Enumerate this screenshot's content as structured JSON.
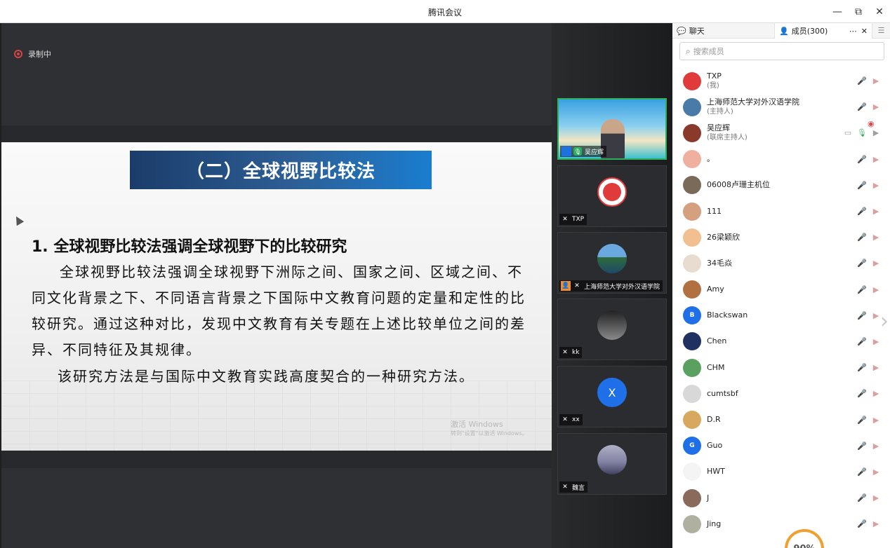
{
  "window": {
    "title": "腾讯会议",
    "minimize": "—",
    "restore": "⧉",
    "close": "✕"
  },
  "stage": {
    "recording_label": "录制中",
    "slide": {
      "banner": "（二）全球视野比较法",
      "heading": "1. 全球视野比较法强调全球视野下的比较研究",
      "paragraph": "全球视野比较法强调全球视野下洲际之间、国家之间、区域之间、不同文化背景之下、不同语言背景之下国际中文教育问题的定量和定性的比较研究。通过这种对比，发现中文教育有关专题在上述比较单位之间的差异、不同特征及其规律。",
      "paragraph2": "该研究方法是与国际中文教育实践高度契合的一种研究方法。",
      "watermark_line1": "激活 Windows",
      "watermark_line2": "转到\"设置\"以激活 Windows。"
    }
  },
  "video_tiles": [
    {
      "name": "吴应辉",
      "type": "video",
      "speaking": true
    },
    {
      "name": "TXP",
      "type": "avatar"
    },
    {
      "name": "上海师范大学对外汉语学院",
      "type": "avatar"
    },
    {
      "name": "kk",
      "type": "avatar"
    },
    {
      "name": "xx",
      "type": "letter",
      "letter": "X"
    },
    {
      "name": "魏言",
      "type": "avatar"
    }
  ],
  "panel": {
    "tab_chat": "聊天",
    "tab_members": "成员(300)",
    "tab_more": "⋯",
    "tab_close": "✕",
    "search_placeholder": "搜索成员",
    "gauge": "90%",
    "members": [
      {
        "name": "TXP",
        "role": "(我)",
        "avatar_color": "#e03a3a"
      },
      {
        "name": "上海师范大学对外汉语学院",
        "role": "(主持人)",
        "avatar_color": "#4a7aa8",
        "recording": true
      },
      {
        "name": "吴应辉",
        "role": "(联席主持人)",
        "avatar_color": "#8a3a2a",
        "speaking": true
      },
      {
        "name": "。",
        "role": "",
        "avatar_color": "#f0b0a0"
      },
      {
        "name": "06008卢珊主机位",
        "role": "",
        "avatar_color": "#7a6a5a"
      },
      {
        "name": "111",
        "role": "",
        "avatar_color": "#d4a080"
      },
      {
        "name": "26梁颖欣",
        "role": "",
        "avatar_color": "#f2c090"
      },
      {
        "name": "34毛焱",
        "role": "",
        "avatar_color": "#e8dcd0"
      },
      {
        "name": "Amy",
        "role": "",
        "avatar_color": "#b07040"
      },
      {
        "name": "Blackswan",
        "role": "",
        "avatar_color": "#1e6fe8",
        "letter": "B"
      },
      {
        "name": "Chen",
        "role": "",
        "avatar_color": "#203060"
      },
      {
        "name": "CHM",
        "role": "",
        "avatar_color": "#5aa060"
      },
      {
        "name": "cumtsbf",
        "role": "",
        "avatar_color": "#d8d8d8"
      },
      {
        "name": "D.R",
        "role": "",
        "avatar_color": "#d8a860"
      },
      {
        "name": "Guo",
        "role": "",
        "avatar_color": "#1e6fe8",
        "letter": "G"
      },
      {
        "name": "HWT",
        "role": "",
        "avatar_color": "#f4f4f4"
      },
      {
        "name": "J",
        "role": "",
        "avatar_color": "#8a6a5a"
      },
      {
        "name": "Jing",
        "role": "",
        "avatar_color": "#b0b0a0"
      }
    ]
  }
}
